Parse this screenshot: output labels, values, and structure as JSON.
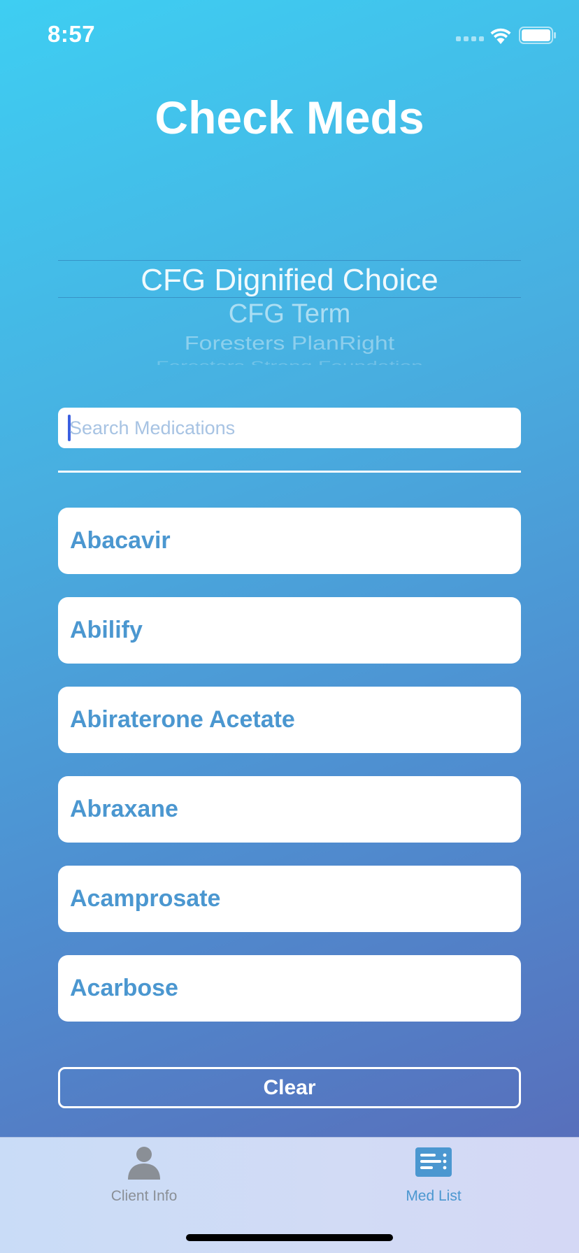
{
  "status_bar": {
    "time": "8:57"
  },
  "header": {
    "title": "Check Meds"
  },
  "plan_picker": {
    "selected": "CFG Dignified Choice",
    "options_below": [
      "CFG Term",
      "Foresters PlanRight",
      "Foresters Strong Foundation"
    ]
  },
  "search": {
    "placeholder": "Search Medications",
    "value": ""
  },
  "medications": [
    "Abacavir",
    "Abilify",
    "Abiraterone Acetate",
    "Abraxane",
    "Acamprosate",
    "Acarbose"
  ],
  "actions": {
    "clear_label": "Clear"
  },
  "tab_bar": {
    "tabs": [
      {
        "label": "Client Info",
        "icon": "person-icon",
        "active": false
      },
      {
        "label": "Med List",
        "icon": "list-icon",
        "active": true
      }
    ]
  },
  "colors": {
    "gradient_top": "#3ecef2",
    "gradient_bottom": "#5a67b6",
    "accent": "#4b97d0",
    "tab_bar_bg": "#d2dbf5",
    "inactive_tab": "#8a8f96"
  }
}
